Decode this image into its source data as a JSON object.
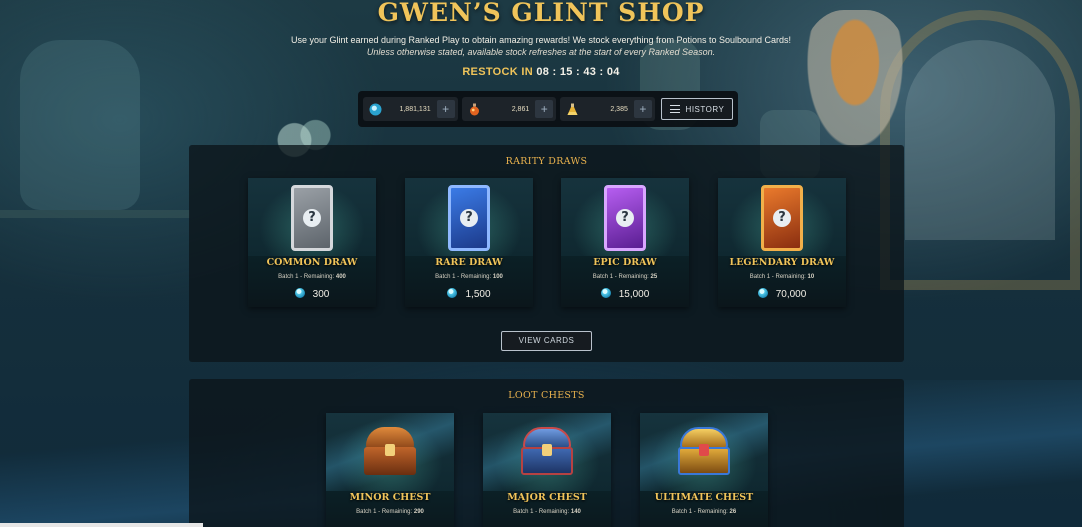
{
  "header": {
    "title": "GWEN’S GLINT SHOP",
    "intro": "Use your Glint earned during Ranked Play to obtain amazing rewards! We stock everything from Potions to Soulbound Cards!",
    "intro_sub": "Unless otherwise stated, available stock refreshes at the start of every Ranked Season.",
    "restock_label": "RESTOCK IN",
    "restock_timer": "08 : 15 : 43 : 04"
  },
  "currencies": [
    {
      "icon": "glint-icon",
      "value": "1,881,131",
      "plus": "+"
    },
    {
      "icon": "potion-icon",
      "value": "2,861",
      "plus": "+"
    },
    {
      "icon": "flask-icon",
      "value": "2,385",
      "plus": "+"
    }
  ],
  "history_label": "HISTORY",
  "rarity_draws": {
    "title": "RARITY DRAWS",
    "items": [
      {
        "name": "COMMON DRAW",
        "batch": "Batch 1",
        "remaining_label": "Remaining:",
        "remaining": "400",
        "price": "300",
        "color": "#c9ccd0"
      },
      {
        "name": "RARE DRAW",
        "batch": "Batch 1",
        "remaining_label": "Remaining:",
        "remaining": "100",
        "price": "1,500",
        "color": "#3f7de0"
      },
      {
        "name": "EPIC DRAW",
        "batch": "Batch 1",
        "remaining_label": "Remaining:",
        "remaining": "25",
        "price": "15,000",
        "color": "#b05ae6"
      },
      {
        "name": "LEGENDARY DRAW",
        "batch": "Batch 1",
        "remaining_label": "Remaining:",
        "remaining": "10",
        "price": "70,000",
        "color": "#e0702a"
      }
    ],
    "view_cards_label": "VIEW CARDS"
  },
  "loot_chests": {
    "title": "LOOT CHESTS",
    "items": [
      {
        "name": "MINOR CHEST",
        "batch": "Batch 1",
        "remaining_label": "Remaining:",
        "remaining": "290",
        "color": "#c8702e"
      },
      {
        "name": "MAJOR CHEST",
        "batch": "Batch 1",
        "remaining_label": "Remaining:",
        "remaining": "140",
        "color": "#3d6bb0"
      },
      {
        "name": "ULTIMATE CHEST",
        "batch": "Batch 1",
        "remaining_label": "Remaining:",
        "remaining": "26",
        "color": "#d6a23a"
      }
    ]
  }
}
